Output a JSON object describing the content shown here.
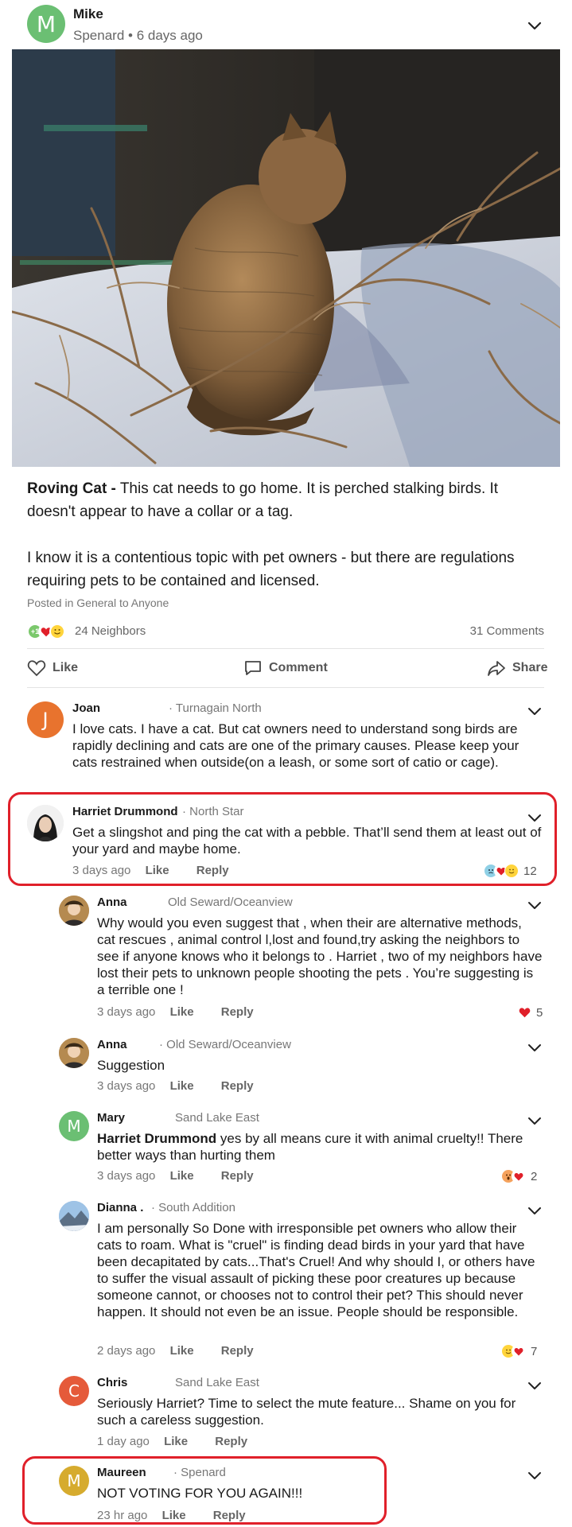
{
  "post": {
    "author": "Mike",
    "avatar_letter": "M",
    "neighborhood": "Spenard",
    "time": "6 days ago",
    "title": "Roving Cat -",
    "body_line1": " This cat needs to go home. It is perched stalking birds. It doesn't appear to have a collar or a tag.",
    "body_para2": "I know it is a contentious topic with pet owners - but there are regulations requiring pets to be contained and licensed.",
    "posted_in": "Posted in General to Anyone",
    "reaction_plus": "+1",
    "neighbors": "24 Neighbors",
    "comments_count": "31 Comments",
    "actions": {
      "like": "Like",
      "comment": "Comment",
      "share": "Share"
    }
  },
  "comments": [
    {
      "name": "Joan",
      "avatar_letter": "J",
      "avatar_color": "#e8732e",
      "hood": "· Turnagain North",
      "text": "I love cats. I have a cat. But cat owners need to understand song birds are rapidly declining and cats are one of the primary causes. Please keep your cats restrained when outside(on a leash, or some sort of catio or cage)."
    },
    {
      "name": "Harriet Drummond",
      "hood": "· North Star",
      "text": "Get a slingshot and ping the cat with a pebble. That’ll send them at least out of your yard and maybe home.",
      "time": "3 days ago",
      "like": "Like",
      "reply": "Reply",
      "reactions": "12"
    },
    {
      "name": "Anna",
      "hood": "Old Seward/Oceanview",
      "text": "Why would you even suggest that , when their are alternative methods, cat rescues , animal control l,lost  and found,try asking the neighbors to see if anyone knows who it belongs to . Harriet , two of my neighbors have lost their pets to unknown people shooting the pets . You’re suggesting is a terrible one !",
      "time": "3 days ago",
      "like": "Like",
      "reply": "Reply",
      "reactions": "5"
    },
    {
      "name": "Anna",
      "hood": "· Old Seward/Oceanview",
      "text": "Suggestion",
      "time": "3 days ago",
      "like": "Like",
      "reply": "Reply"
    },
    {
      "name": "Mary",
      "avatar_letter": "M",
      "avatar_color": "#6bbf73",
      "hood": "Sand Lake East",
      "mention": "Harriet Drummond",
      "text": " yes by all means cure it with animal cruelty!! There better ways than hurting them",
      "time": "3 days ago",
      "like": "Like",
      "reply": "Reply",
      "reactions": "2"
    },
    {
      "name": "Dianna",
      "name_suffix": ".",
      "hood": "· South Addition",
      "text": "I am personally So Done with irresponsible pet owners who allow their cats to roam.  What is \"cruel\" is finding dead birds in your yard that have been decapitated by cats...That's Cruel!   And why should I, or others have to suffer the visual assault of picking these poor creatures up because someone cannot, or chooses not to control their pet?  This should never happen.  It should not even be an issue.  People should be responsible.",
      "time": "2 days ago",
      "like": "Like",
      "reply": "Reply",
      "reactions": "7"
    },
    {
      "name": "Chris",
      "avatar_letter": "C",
      "avatar_color": "#e55a3a",
      "hood": "Sand Lake East",
      "text": "Seriously Harriet?  Time to select the mute feature...  Shame on you for such a careless suggestion.",
      "time": "1 day ago",
      "like": "Like",
      "reply": "Reply"
    },
    {
      "name": "Maureen",
      "avatar_letter": "M",
      "avatar_color": "#d6ab2e",
      "hood": "· Spenard",
      "text": "NOT VOTING FOR YOU AGAIN!!!",
      "time": "23 hr ago",
      "like": "Like",
      "reply": "Reply"
    }
  ],
  "colors": {
    "highlight": "#e0202a",
    "green_avatar": "#6bbf73"
  }
}
